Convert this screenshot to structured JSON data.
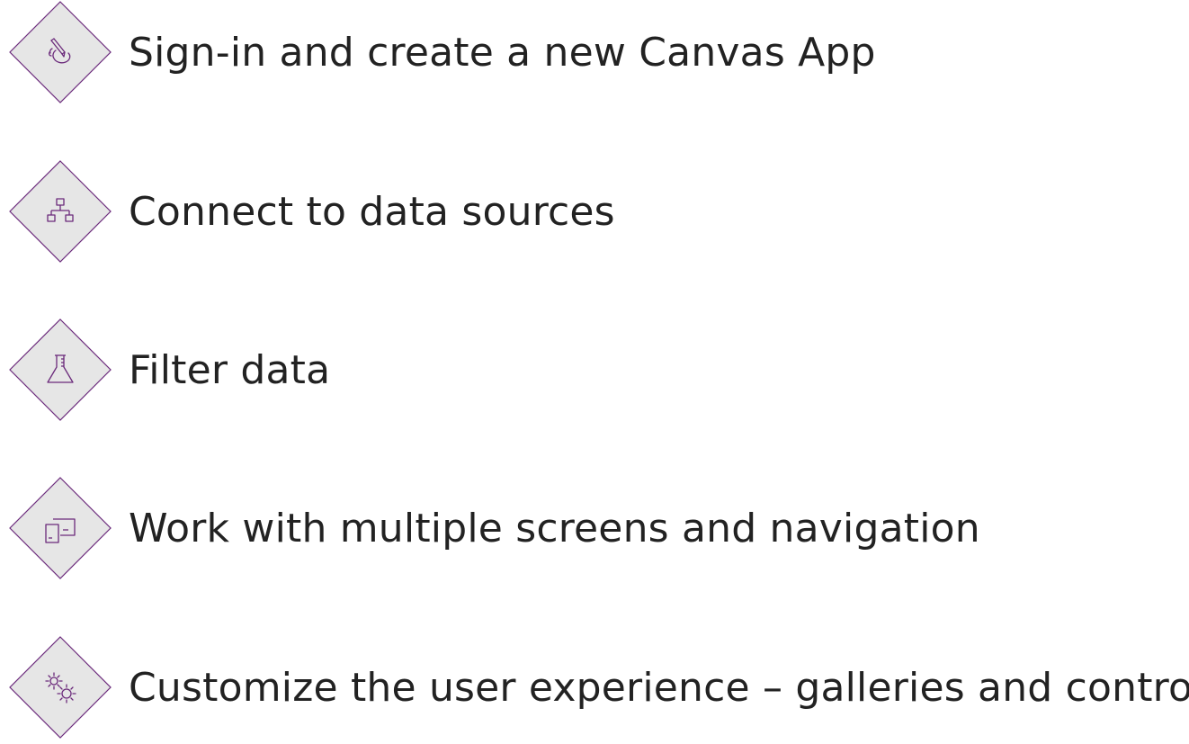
{
  "colors": {
    "accent": "#6b2a7b",
    "diamond_fill": "#e6e6e6",
    "diamond_border": "#6b2a7b",
    "text": "#222222",
    "background": "#ffffff"
  },
  "agenda": {
    "items": [
      {
        "label": "Sign-in and create a new Canvas App",
        "icon": "pen-hand-icon"
      },
      {
        "label": "Connect to data sources",
        "icon": "hierarchy-icon"
      },
      {
        "label": "Filter data",
        "icon": "flask-icon"
      },
      {
        "label": "Work with multiple screens and navigation",
        "icon": "devices-icon"
      },
      {
        "label": "Customize the user experience – galleries and controls",
        "icon": "gears-icon"
      }
    ]
  }
}
